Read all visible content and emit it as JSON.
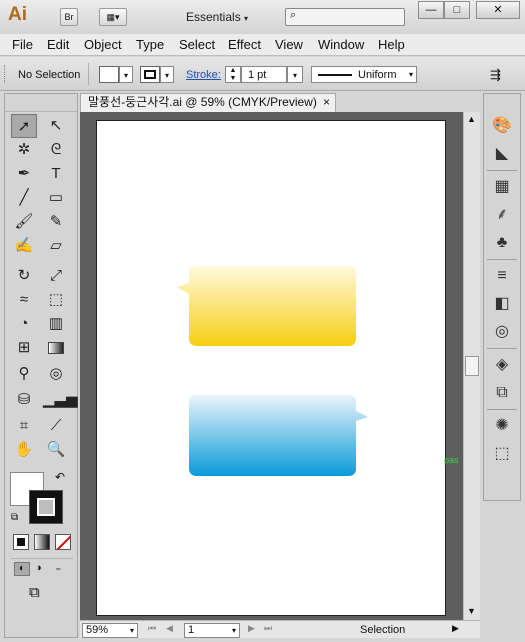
{
  "app": {
    "logo": "Ai",
    "bridge": "Br",
    "workspace": "Essentials",
    "search_placeholder": ""
  },
  "window_buttons": {
    "min": "—",
    "max": "□",
    "close": "✕"
  },
  "menu": [
    "File",
    "Edit",
    "Object",
    "Type",
    "Select",
    "Effect",
    "View",
    "Window",
    "Help"
  ],
  "control": {
    "selection": "No Selection",
    "stroke_label": "Stroke:",
    "stroke_weight": "1 pt",
    "profile": "Uniform"
  },
  "doc": {
    "tab_title": "말풍선-둥근사각.ai @ 59% (CMYK/Preview)",
    "close": "×"
  },
  "status": {
    "zoom": "59%",
    "artboard": "1",
    "tool": "Selection"
  },
  "canvas": {
    "pasteboard_label": "pas"
  },
  "colors": {
    "yellow_top": "#fff9dc",
    "yellow_bottom": "#f6cf14",
    "blue_top": "#e9f5fb",
    "blue_bottom": "#0a9ad8",
    "accent": "#b06a1c"
  },
  "tools": [
    [
      "selection-tool",
      "direct-selection-tool"
    ],
    [
      "magic-wand-tool",
      "lasso-tool"
    ],
    [
      "pen-tool",
      "type-tool"
    ],
    [
      "line-tool",
      "rectangle-tool"
    ],
    [
      "paintbrush-tool",
      "pencil-tool"
    ],
    [
      "blob-brush-tool",
      "eraser-tool"
    ],
    [
      "rotate-tool",
      "scale-tool"
    ],
    [
      "width-tool",
      "free-transform-tool"
    ],
    [
      "shape-builder-tool",
      "perspective-grid-tool"
    ],
    [
      "mesh-tool",
      "gradient-tool"
    ],
    [
      "eyedropper-tool",
      "blend-tool"
    ],
    [
      "symbol-sprayer-tool",
      "column-graph-tool"
    ],
    [
      "artboard-tool",
      "slice-tool"
    ],
    [
      "hand-tool",
      "zoom-tool"
    ]
  ]
}
